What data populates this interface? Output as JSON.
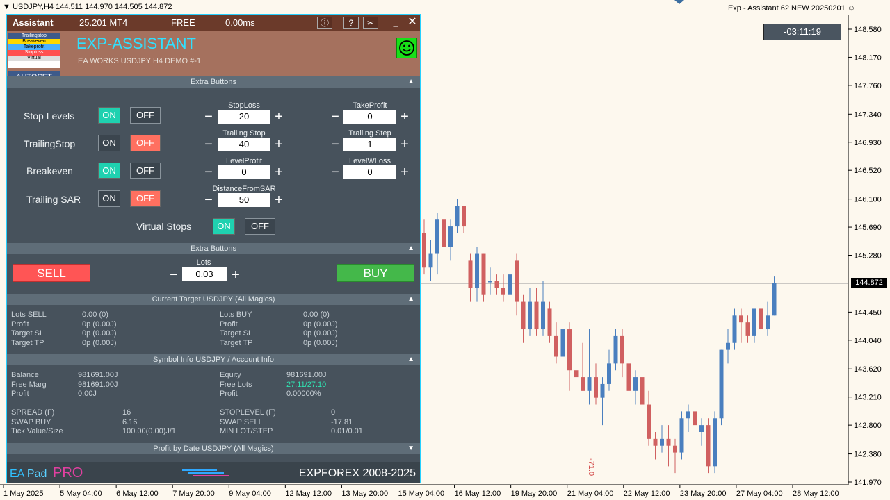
{
  "terminal": {
    "symbol_header": "USDJPY,H4  144.511 144.970 144.505 144.872",
    "ea_label": "Exp - Assistant 62 NEW 20250201",
    "timer": "-03:11:19",
    "current_price": "144.872",
    "vertical_note": "-71.0"
  },
  "panel": {
    "top": {
      "title": "Assistant",
      "version": "25.201 MT4",
      "mode": "FREE",
      "latency": "0.00ms"
    },
    "header": {
      "title": "EXP-ASSISTANT",
      "subtitle": "EA WORKS USDJPY H4 DEMO  #-1",
      "autoset": "AUTOSET",
      "logo_lines": [
        "Trailingstop",
        "Breakeven",
        "Takeprofit",
        "Stoploss",
        "Virtual"
      ]
    },
    "sections": {
      "extra1": "Extra Buttons",
      "extra2": "Extra Buttons",
      "target": "Current Target USDJPY (All Magics)",
      "symbol": "Symbol Info USDJPY / Account Info",
      "profit": "Profit by Date USDJPY (All Magics)"
    },
    "on_label": "ON",
    "off_label": "OFF",
    "rows": {
      "stop_levels": "Stop Levels",
      "trailing_stop": "TrailingStop",
      "breakeven": "Breakeven",
      "trailing_sar": "Trailing SAR",
      "virtual_stops": "Virtual Stops"
    },
    "spinners": {
      "stoploss": {
        "label": "StopLoss",
        "value": "20"
      },
      "takeprofit": {
        "label": "TakeProfit",
        "value": "0"
      },
      "trailing_stop": {
        "label": "Trailing Stop",
        "value": "40"
      },
      "trailing_step": {
        "label": "Trailing Step",
        "value": "1"
      },
      "level_profit": {
        "label": "LevelProfit",
        "value": "0"
      },
      "level_wloss": {
        "label": "LevelWLoss",
        "value": "0"
      },
      "distance_sar": {
        "label": "DistanceFromSAR",
        "value": "50"
      },
      "lots": {
        "label": "Lots",
        "value": "0.03"
      }
    },
    "sell": "SELL",
    "buy": "BUY",
    "target": {
      "left": [
        [
          "Lots SELL",
          "0.00 (0)"
        ],
        [
          "Profit",
          "0p (0.00J)"
        ],
        [
          "Target SL",
          "0p (0.00J)"
        ],
        [
          "Target TP",
          "0p (0.00J)"
        ]
      ],
      "right": [
        [
          "Lots BUY",
          "0.00 (0)"
        ],
        [
          "Profit",
          "0p (0.00J)"
        ],
        [
          "Target SL",
          "0p (0.00J)"
        ],
        [
          "Target TP",
          "0p (0.00J)"
        ]
      ]
    },
    "account": {
      "balance_l": "Balance",
      "balance": "981691.00J",
      "freemarg_l": "Free Marg",
      "freemarg": "981691.00J",
      "profit_l": "Profit",
      "profit": "0.00J",
      "equity_l": "Equity",
      "equity": "981691.00J",
      "freelots_l": "Free Lots",
      "freelots": "27.11/27.10",
      "profit2_l": "Profit",
      "profit2": "0.00000%",
      "spread_l": "SPREAD (F)",
      "spread": "16",
      "swapbuy_l": "SWAP BUY",
      "swapbuy": "6.16",
      "tick_l": "Tick Value/Size",
      "tick": "100.00(0.00)J/1",
      "stoplevel_l": "STOPLEVEL (F)",
      "stoplevel": "0",
      "swapsell_l": "SWAP SELL",
      "swapsell": "-17.81",
      "minlot_l": "MIN LOT/STEP",
      "minlot": "0.01/0.01"
    },
    "footer": {
      "brand_a": "EA",
      "brand_b": "Pad",
      "pro": "PRO",
      "copyright": "EXPFOREX 2008-2025"
    }
  },
  "chart_data": {
    "type": "candlestick",
    "y_ticks": [
      "148.580",
      "148.170",
      "147.760",
      "147.340",
      "146.930",
      "146.520",
      "146.100",
      "145.690",
      "145.280",
      "144.450",
      "144.040",
      "143.620",
      "143.210",
      "142.800",
      "142.380",
      "141.970"
    ],
    "x_ticks": [
      "1 May 2025",
      "5 May 04:00",
      "6 May 12:00",
      "7 May 20:00",
      "9 May 04:00",
      "12 May 12:00",
      "13 May 20:00",
      "15 May 04:00",
      "16 May 12:00",
      "19 May 20:00",
      "21 May 04:00",
      "22 May 12:00",
      "23 May 20:00",
      "27 May 04:00",
      "28 May 12:00"
    ],
    "ylim": [
      141.97,
      148.58
    ],
    "up_color": "#4a7fbf",
    "down_color": "#d06060",
    "candles": [
      {
        "o": 145.6,
        "h": 145.8,
        "l": 145.0,
        "c": 145.1
      },
      {
        "o": 145.1,
        "h": 145.5,
        "l": 144.9,
        "c": 145.3
      },
      {
        "o": 145.3,
        "h": 145.9,
        "l": 145.0,
        "c": 145.8
      },
      {
        "o": 145.8,
        "h": 145.9,
        "l": 145.3,
        "c": 145.4
      },
      {
        "o": 145.4,
        "h": 145.8,
        "l": 145.2,
        "c": 145.7
      },
      {
        "o": 145.7,
        "h": 146.1,
        "l": 145.6,
        "c": 146.0
      },
      {
        "o": 146.0,
        "h": 146.0,
        "l": 145.6,
        "c": 145.7
      },
      {
        "o": 145.2,
        "h": 145.3,
        "l": 144.6,
        "c": 144.8
      },
      {
        "o": 144.8,
        "h": 145.4,
        "l": 144.6,
        "c": 145.3
      },
      {
        "o": 145.3,
        "h": 145.3,
        "l": 144.6,
        "c": 144.7
      },
      {
        "o": 144.9,
        "h": 145.1,
        "l": 144.7,
        "c": 144.9
      },
      {
        "o": 144.9,
        "h": 145.0,
        "l": 144.7,
        "c": 144.8
      },
      {
        "o": 144.8,
        "h": 145.0,
        "l": 144.6,
        "c": 144.7
      },
      {
        "o": 144.7,
        "h": 145.1,
        "l": 144.6,
        "c": 145.0
      },
      {
        "o": 145.2,
        "h": 145.3,
        "l": 144.4,
        "c": 144.6
      },
      {
        "o": 144.6,
        "h": 144.7,
        "l": 144.0,
        "c": 144.2
      },
      {
        "o": 144.2,
        "h": 144.8,
        "l": 144.1,
        "c": 144.6
      },
      {
        "o": 144.6,
        "h": 144.8,
        "l": 144.1,
        "c": 144.2
      },
      {
        "o": 144.2,
        "h": 144.9,
        "l": 144.1,
        "c": 144.6
      },
      {
        "o": 144.5,
        "h": 144.6,
        "l": 144.0,
        "c": 144.1
      },
      {
        "o": 144.1,
        "h": 144.3,
        "l": 143.7,
        "c": 143.8
      },
      {
        "o": 143.8,
        "h": 144.2,
        "l": 143.4,
        "c": 144.2
      },
      {
        "o": 144.2,
        "h": 144.3,
        "l": 143.3,
        "c": 143.6
      },
      {
        "o": 143.6,
        "h": 143.7,
        "l": 143.1,
        "c": 143.5
      },
      {
        "o": 143.5,
        "h": 144.0,
        "l": 143.3,
        "c": 143.3
      },
      {
        "o": 143.3,
        "h": 144.2,
        "l": 143.1,
        "c": 143.5
      },
      {
        "o": 143.5,
        "h": 143.7,
        "l": 143.1,
        "c": 143.2
      },
      {
        "o": 143.2,
        "h": 143.5,
        "l": 142.8,
        "c": 143.4
      },
      {
        "o": 143.4,
        "h": 143.9,
        "l": 143.3,
        "c": 143.7
      },
      {
        "o": 143.7,
        "h": 144.2,
        "l": 143.6,
        "c": 144.1
      },
      {
        "o": 144.1,
        "h": 144.2,
        "l": 143.5,
        "c": 143.7
      },
      {
        "o": 143.7,
        "h": 143.9,
        "l": 143.0,
        "c": 143.3
      },
      {
        "o": 143.3,
        "h": 143.6,
        "l": 143.1,
        "c": 143.5
      },
      {
        "o": 143.5,
        "h": 143.7,
        "l": 143.0,
        "c": 143.1
      },
      {
        "o": 143.1,
        "h": 143.3,
        "l": 142.5,
        "c": 142.6
      },
      {
        "o": 142.6,
        "h": 142.7,
        "l": 142.3,
        "c": 142.5
      },
      {
        "o": 142.5,
        "h": 142.8,
        "l": 142.4,
        "c": 142.6
      },
      {
        "o": 142.6,
        "h": 142.8,
        "l": 142.2,
        "c": 142.5
      },
      {
        "o": 142.5,
        "h": 142.6,
        "l": 142.1,
        "c": 142.4
      },
      {
        "o": 142.4,
        "h": 143.0,
        "l": 142.3,
        "c": 142.9
      },
      {
        "o": 142.9,
        "h": 143.1,
        "l": 142.7,
        "c": 143.0
      },
      {
        "o": 143.0,
        "h": 143.0,
        "l": 142.6,
        "c": 142.8
      },
      {
        "o": 142.7,
        "h": 142.9,
        "l": 142.5,
        "c": 142.8
      },
      {
        "o": 142.8,
        "h": 142.9,
        "l": 142.1,
        "c": 142.2
      },
      {
        "o": 142.2,
        "h": 143.0,
        "l": 142.1,
        "c": 142.9
      },
      {
        "o": 142.9,
        "h": 143.9,
        "l": 142.8,
        "c": 143.9
      },
      {
        "o": 143.9,
        "h": 144.2,
        "l": 143.7,
        "c": 144.0
      },
      {
        "o": 144.0,
        "h": 144.5,
        "l": 143.9,
        "c": 144.4
      },
      {
        "o": 144.4,
        "h": 144.5,
        "l": 144.0,
        "c": 144.3
      },
      {
        "o": 144.3,
        "h": 144.4,
        "l": 144.0,
        "c": 144.1
      },
      {
        "o": 144.1,
        "h": 144.5,
        "l": 144.0,
        "c": 144.5
      },
      {
        "o": 144.5,
        "h": 144.7,
        "l": 144.1,
        "c": 144.2
      },
      {
        "o": 144.2,
        "h": 144.6,
        "l": 144.1,
        "c": 144.4
      },
      {
        "o": 144.4,
        "h": 144.97,
        "l": 144.4,
        "c": 144.87
      }
    ]
  }
}
